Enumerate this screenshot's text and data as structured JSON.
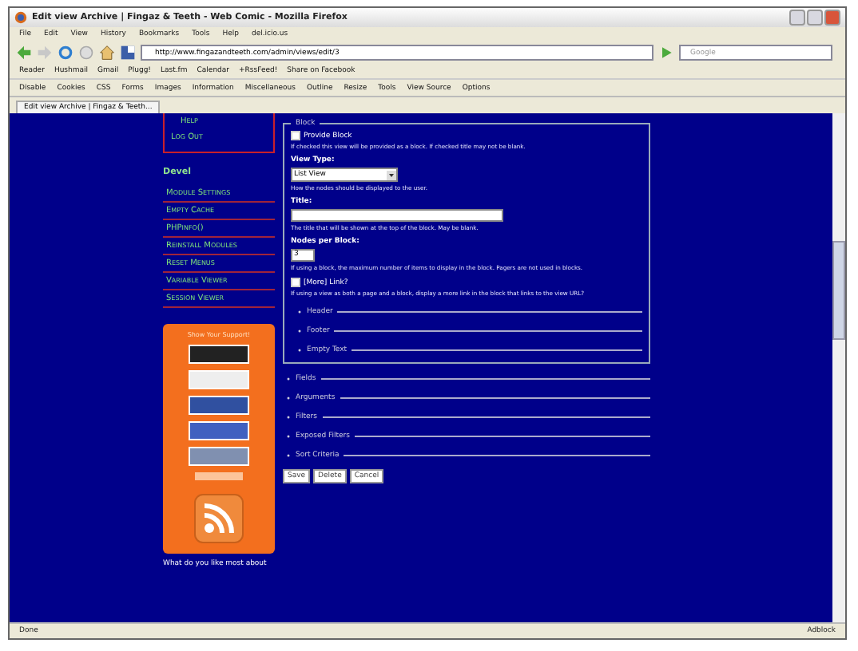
{
  "window": {
    "title": "Edit view Archive | Fingaz & Teeth - Web Comic - Mozilla Firefox"
  },
  "menu_bar": [
    "File",
    "Edit",
    "View",
    "History",
    "Bookmarks",
    "Tools",
    "Help",
    "del.icio.us"
  ],
  "nav": {
    "url": "http://www.fingazandteeth.com/admin/views/edit/3",
    "search_placeholder": "Google"
  },
  "bookmarks": [
    "Reader",
    "Hushmail",
    "Gmail",
    "Plugg!",
    "Last.fm",
    "Calendar",
    "+RssFeed!",
    "Share on Facebook"
  ],
  "dev_toolbar": [
    "Disable",
    "Cookies",
    "CSS",
    "Forms",
    "Images",
    "Information",
    "Miscellaneous",
    "Outline",
    "Resize",
    "Tools",
    "View Source",
    "Options"
  ],
  "tabs": [
    {
      "label": "Edit view Archive | Fingaz & Teeth...",
      "selected": true
    }
  ],
  "sidebar": {
    "account_links": [
      "Help",
      "Log Out"
    ],
    "devel_heading": "Devel",
    "devel_items": [
      "Module Settings",
      "Empty Cache",
      "PHPinfo()",
      "Reinstall Modules",
      "Reset Menus",
      "Variable Viewer",
      "Session Viewer"
    ],
    "support_heading": "Show Your Support!",
    "footer_text": "What do you like most about"
  },
  "form": {
    "legend": "Block",
    "fields": [
      {
        "kind": "checkbox",
        "label": "Provide Block",
        "checked": false,
        "description": "If checked this view will be provided as a block. If checked title may not be blank."
      },
      {
        "kind": "select",
        "label": "View Type:",
        "value": "List View",
        "description": "How the nodes should be displayed to the user."
      },
      {
        "kind": "text",
        "label": "Title:",
        "description": "The title that will be shown at the top of the block. May be blank."
      },
      {
        "kind": "number",
        "label": "Nodes per Block:",
        "value": "3",
        "description": "If using a block, the maximum number of items to display in the block. Pagers are not used in blocks."
      },
      {
        "kind": "checkbox",
        "label": "[More] Link?",
        "checked": false,
        "description": "If using a view as both a page and a block, display a more link in the block that links to the view URL?"
      }
    ],
    "inner_sections": [
      "Header",
      "Footer",
      "Empty Text"
    ],
    "sections": [
      "Fields",
      "Arguments",
      "Filters",
      "Exposed Filters",
      "Sort Criteria"
    ],
    "buttons": [
      "Save",
      "Delete",
      "Cancel"
    ]
  },
  "status_bar": {
    "text": "Done",
    "addon": "Adblock"
  }
}
